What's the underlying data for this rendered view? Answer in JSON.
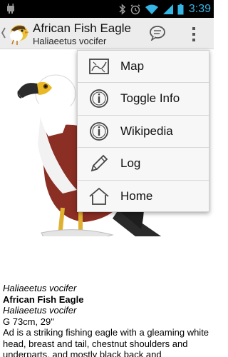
{
  "status_bar": {
    "time": "3:39"
  },
  "action_bar": {
    "title": "African Fish Eagle",
    "subtitle": "Haliaeetus vocifer"
  },
  "menu": {
    "items": [
      {
        "label": "Map",
        "icon": "map-icon"
      },
      {
        "label": "Toggle Info",
        "icon": "info-icon"
      },
      {
        "label": "Wikipedia",
        "icon": "info-icon"
      },
      {
        "label": "Log",
        "icon": "pencil-icon"
      },
      {
        "label": "Home",
        "icon": "home-icon"
      }
    ]
  },
  "description": {
    "scientific_name": "Haliaeetus vocifer",
    "common_name": "African Fish Eagle",
    "scientific_name_repeat": "Haliaeetus vocifer",
    "size": "G 73cm, 29\"",
    "text": "Ad is a striking fishing eagle with a gleaming white head, breast and tail, chestnut shoulders and underparts, and mostly black back and"
  },
  "colors": {
    "status_clock": "#33b5e5",
    "action_bar_bg": "#ececec",
    "menu_bg": "#f7f7f7"
  }
}
